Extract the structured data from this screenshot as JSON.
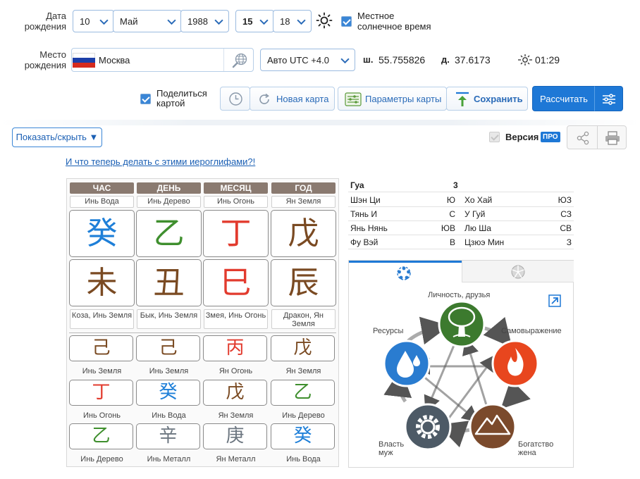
{
  "birth_date": {
    "label_line1": "Дата",
    "label_line2": "рождения",
    "day": "10",
    "month": "Май",
    "year": "1988",
    "hour": "15",
    "minute": "18",
    "local_solar_time_line1": "Местное",
    "local_solar_time_line2": "солнечное время"
  },
  "birth_place": {
    "label_line1": "Место",
    "label_line2": "рождения",
    "city": "Москва",
    "timezone": "Авто UTC +4.0",
    "lat_label": "ш.",
    "lat": "55.755826",
    "lon_label": "д.",
    "lon": "37.6173",
    "solar_time": "01:29"
  },
  "toolbar": {
    "share_line1": "Поделиться",
    "share_line2": "картой",
    "new_map": "Новая карта",
    "map_params": "Параметры карты",
    "save": "Сохранить",
    "calculate": "Рассчитать"
  },
  "bar2": {
    "show_hide": "Показать/скрыть ▼",
    "version": "Версия",
    "pro": "ПРО"
  },
  "link_text": "И что теперь делать с этими иероглифами?!",
  "pillars": {
    "headers": [
      "ЧАС",
      "ДЕНЬ",
      "МЕСЯЦ",
      "ГОД"
    ],
    "stem_labels": [
      "Инь Вода",
      "Инь Дерево",
      "Инь Огонь",
      "Ян Земля"
    ],
    "stems": [
      {
        "char": "癸",
        "color": "#1e7fd8"
      },
      {
        "char": "乙",
        "color": "#3f8f2e"
      },
      {
        "char": "丁",
        "color": "#e23b2e"
      },
      {
        "char": "戊",
        "color": "#7a4a22"
      }
    ],
    "branches": [
      {
        "char": "未",
        "color": "#7a4a22"
      },
      {
        "char": "丑",
        "color": "#7a4a22"
      },
      {
        "char": "巳",
        "color": "#e23b2e"
      },
      {
        "char": "辰",
        "color": "#7a4a22"
      }
    ],
    "branch_labels": [
      {
        "line1": "Коза, Инь Земля",
        "line2": ""
      },
      {
        "line1": "Бык, Инь Земля",
        "line2": ""
      },
      {
        "line1": "Змея, Инь Огонь",
        "line2": ""
      },
      {
        "line1": "Дракон, Ян",
        "line2": "Земля"
      }
    ],
    "hidden": [
      [
        {
          "char": "己",
          "color": "#7a4a22",
          "label": "Инь Земля"
        },
        {
          "char": "己",
          "color": "#7a4a22",
          "label": "Инь Земля"
        },
        {
          "char": "丙",
          "color": "#e23b2e",
          "label": "Ян Огонь"
        },
        {
          "char": "戊",
          "color": "#7a4a22",
          "label": "Ян Земля"
        }
      ],
      [
        {
          "char": "丁",
          "color": "#e23b2e",
          "label": "Инь Огонь"
        },
        {
          "char": "癸",
          "color": "#1e7fd8",
          "label": "Инь Вода"
        },
        {
          "char": "戊",
          "color": "#7a4a22",
          "label": "Ян Земля"
        },
        {
          "char": "乙",
          "color": "#3f8f2e",
          "label": "Инь Дерево"
        }
      ],
      [
        {
          "char": "乙",
          "color": "#3f8f2e",
          "label": "Инь Дерево"
        },
        {
          "char": "辛",
          "color": "#6c7680",
          "label": "Инь Металл"
        },
        {
          "char": "庚",
          "color": "#6c7680",
          "label": "Ян Металл"
        },
        {
          "char": "癸",
          "color": "#1e7fd8",
          "label": "Инь Вода"
        }
      ]
    ]
  },
  "gua": {
    "label": "Гуа",
    "value": "3",
    "rows": [
      {
        "left_name": "Шэн Ци",
        "left_dir": "Ю",
        "right_name": "Хо Хай",
        "right_dir": "ЮЗ"
      },
      {
        "left_name": "Тянь И",
        "left_dir": "С",
        "right_name": "У Гуй",
        "right_dir": "СЗ"
      },
      {
        "left_name": "Янь Нянь",
        "left_dir": "ЮВ",
        "right_name": "Лю Ша",
        "right_dir": "СВ"
      },
      {
        "left_name": "Фу Вэй",
        "left_dir": "В",
        "right_name": "Цзюэ Мин",
        "right_dir": "З"
      }
    ]
  },
  "elements": {
    "top": "Личность, друзья",
    "right": "Самовыражение",
    "left": "Ресурсы",
    "bottom_left_line1": "Власть",
    "bottom_left_line2": "муж",
    "bottom_right_line1": "Богатство",
    "bottom_right_line2": "жена",
    "colors": {
      "wood": "#3c7a2e",
      "fire": "#e8461e",
      "earth": "#7b4a2c",
      "metal": "#4d5a66",
      "water": "#2a7cd0"
    }
  }
}
